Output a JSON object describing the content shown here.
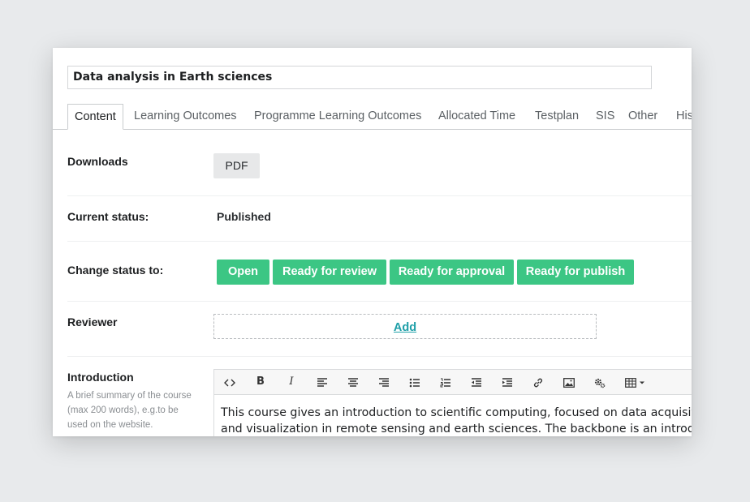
{
  "course": {
    "title": "Data analysis in Earth sciences"
  },
  "tabs": [
    "Content",
    "Learning Outcomes",
    "Programme Learning Outcomes",
    "Allocated Time",
    "Testplan",
    "SIS",
    "Other",
    "His"
  ],
  "downloads": {
    "label": "Downloads",
    "pdf_button": "PDF"
  },
  "status": {
    "label": "Current status:",
    "value": "Published"
  },
  "change_status": {
    "label": "Change status to:",
    "buttons": [
      "Open",
      "Ready for review",
      "Ready for approval",
      "Ready for publish"
    ],
    "color": "#3cc684"
  },
  "reviewer": {
    "label": "Reviewer",
    "add_link": "Add"
  },
  "introduction": {
    "label": "Introduction",
    "help_lines": [
      "A brief summary of the course",
      "(max 200 words), e.g.to be",
      "used on the website."
    ],
    "toolbar_icons": [
      "code-view-icon",
      "bold-icon",
      "italic-icon",
      "align-left-icon",
      "align-center-icon",
      "align-right-icon",
      "bullet-list-icon",
      "numbered-list-icon",
      "outdent-icon",
      "indent-icon",
      "link-icon",
      "image-icon",
      "gear-icon",
      "table-icon"
    ],
    "text_lines": [
      "This course gives an introduction to scientific computing, focused on data acquisiti",
      "and visualization in remote sensing and earth sciences. The backbone is an introdu"
    ]
  }
}
